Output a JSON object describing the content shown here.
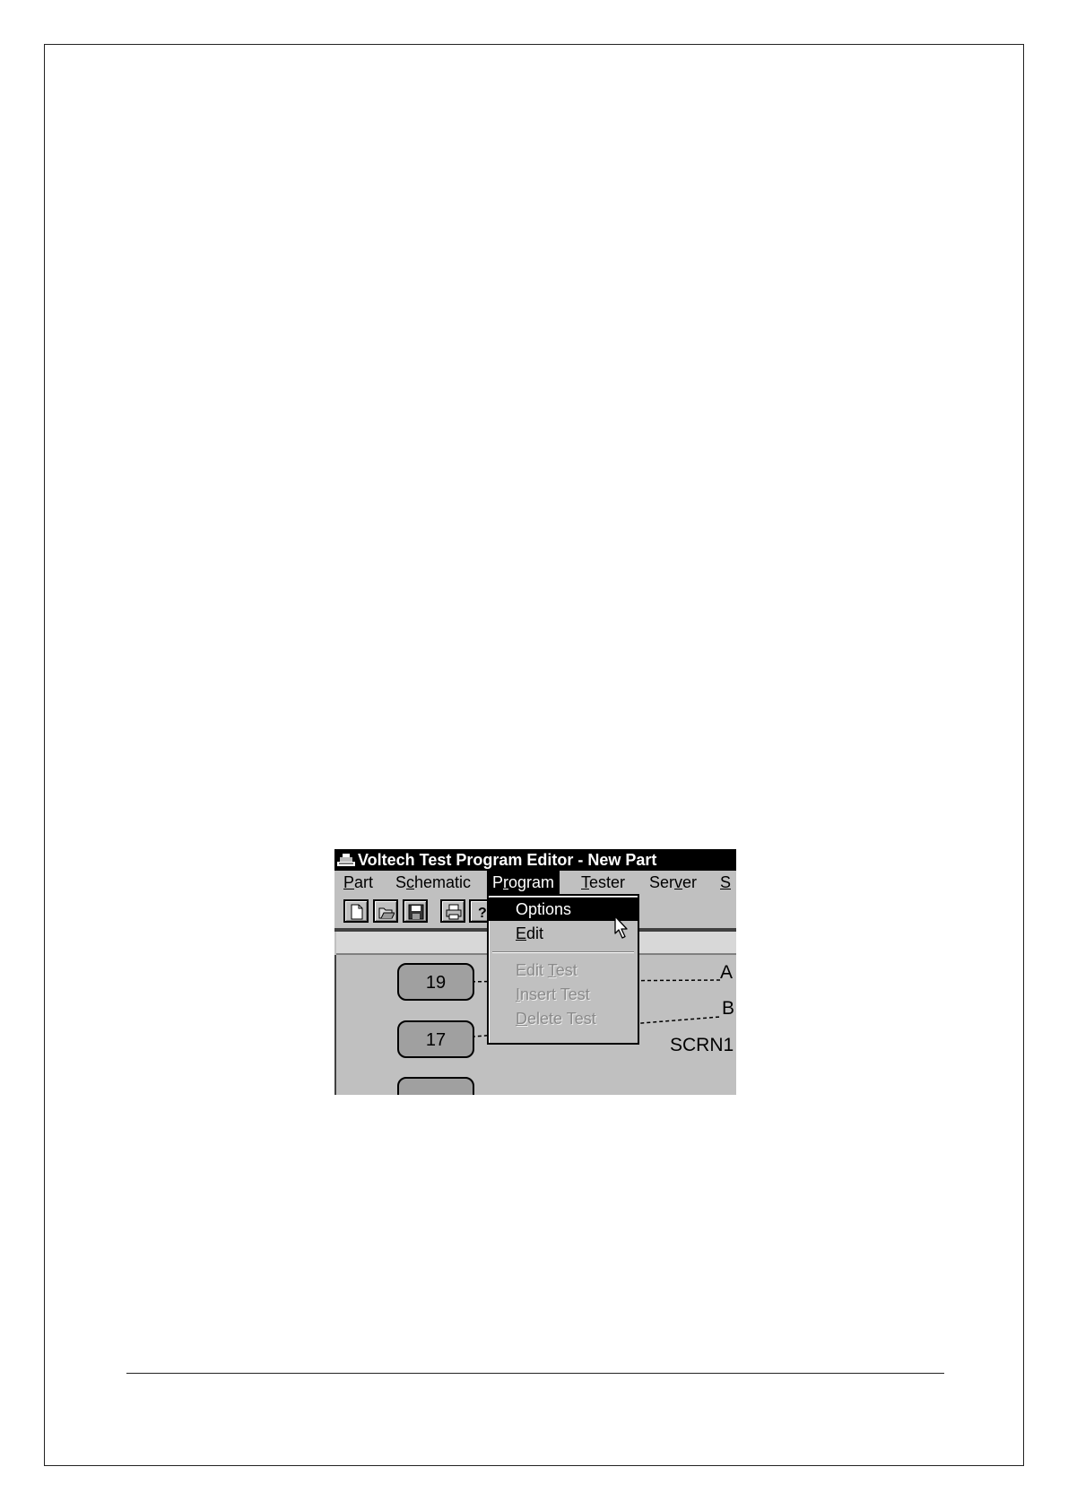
{
  "window": {
    "title": "Voltech Test Program Editor - New Part",
    "app_icon": "voltech-app-icon"
  },
  "menubar": [
    {
      "label": "Part",
      "mnemonic": "P",
      "rest": "art"
    },
    {
      "label": "Schematic",
      "pre": "S",
      "mnemonic": "c",
      "rest": "hematic"
    },
    {
      "label": "Program",
      "pre": "P",
      "mnemonic": "r",
      "rest": "ogram"
    },
    {
      "label": "Tester",
      "mnemonic": "T",
      "rest": "ester"
    },
    {
      "label": "Server",
      "pre": "Ser",
      "mnemonic": "v",
      "rest": "er"
    },
    {
      "label": "S",
      "mnemonic": "S",
      "rest": ""
    }
  ],
  "toolbar": {
    "icons": [
      "new-file-icon",
      "open-folder-icon",
      "save-disk-icon",
      "print-icon",
      "help-icon"
    ]
  },
  "program_menu": {
    "items": [
      {
        "label": "Options",
        "state": "highlighted"
      },
      {
        "label": "Edit",
        "mnemonic": "E",
        "rest": "dit",
        "state": "enabled"
      },
      {
        "label": "Edit Test",
        "pre": "Edit ",
        "mnemonic": "T",
        "rest": "est",
        "state": "disabled"
      },
      {
        "label": "Insert Test",
        "mnemonic": "I",
        "rest": "nsert Test",
        "state": "disabled"
      },
      {
        "label": "Delete Test",
        "mnemonic": "D",
        "rest": "elete Test",
        "state": "disabled"
      }
    ]
  },
  "schematic": {
    "pins": [
      {
        "number": "19"
      },
      {
        "number": "17"
      },
      {
        "number": ""
      }
    ],
    "labels": {
      "a": "A",
      "b": "B",
      "scrn": "SCRN1"
    }
  },
  "colors": {
    "window_bg": "#c0c0c0",
    "titlebar_bg": "#000000",
    "highlight": "#000000",
    "pin_fill": "#a0a0a0"
  }
}
